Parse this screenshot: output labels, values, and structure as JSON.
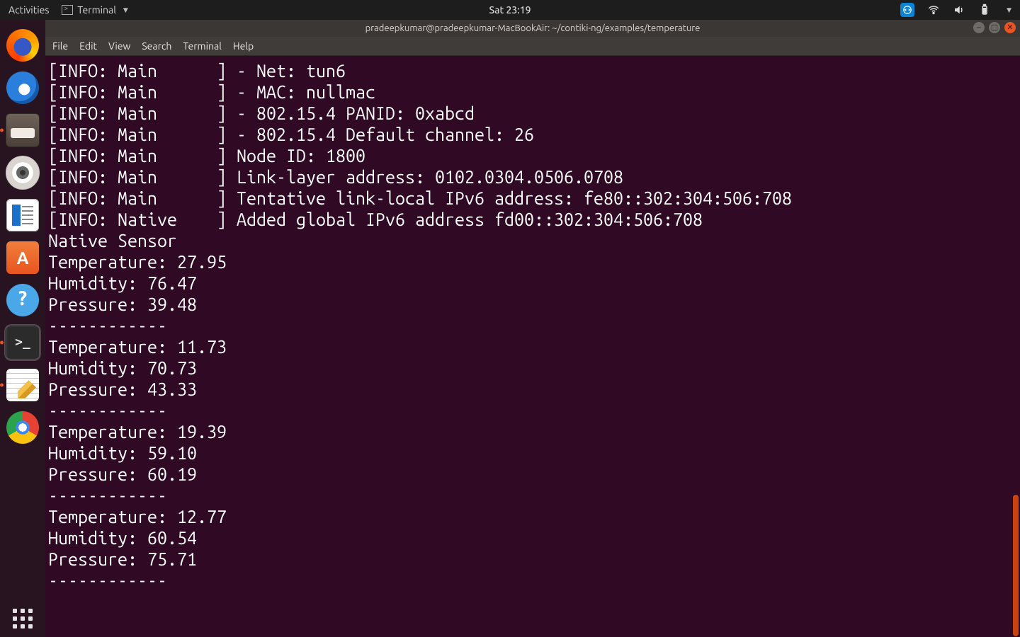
{
  "top_panel": {
    "activities": "Activities",
    "app_indicator": "Terminal",
    "clock": "Sat 23:19"
  },
  "dock_icons": [
    {
      "name": "firefox"
    },
    {
      "name": "thunderbird"
    },
    {
      "name": "files"
    },
    {
      "name": "rhythmbox"
    },
    {
      "name": "libreoffice-writer"
    },
    {
      "name": "ubuntu-software"
    },
    {
      "name": "help"
    },
    {
      "name": "terminal"
    },
    {
      "name": "text-editor"
    },
    {
      "name": "chrome"
    }
  ],
  "window": {
    "title": "pradeepkumar@pradeepkumar-MacBookAir: ~/contiki-ng/examples/temperature",
    "menubar": [
      "File",
      "Edit",
      "View",
      "Search",
      "Terminal",
      "Help"
    ]
  },
  "terminal_lines": [
    "[INFO: Main      ] - Net: tun6",
    "[INFO: Main      ] - MAC: nullmac",
    "[INFO: Main      ] - 802.15.4 PANID: 0xabcd",
    "[INFO: Main      ] - 802.15.4 Default channel: 26",
    "[INFO: Main      ] Node ID: 1800",
    "[INFO: Main      ] Link-layer address: 0102.0304.0506.0708",
    "[INFO: Main      ] Tentative link-local IPv6 address: fe80::302:304:506:708",
    "[INFO: Native    ] Added global IPv6 address fd00::302:304:506:708",
    "Native Sensor",
    "Temperature: 27.95",
    "Humidity: 76.47",
    "Pressure: 39.48",
    "------------",
    "Temperature: 11.73",
    "Humidity: 70.73",
    "Pressure: 43.33",
    "------------",
    "Temperature: 19.39",
    "Humidity: 59.10",
    "Pressure: 60.19",
    "------------",
    "Temperature: 12.77",
    "Humidity: 60.54",
    "Pressure: 75.71",
    "------------"
  ]
}
